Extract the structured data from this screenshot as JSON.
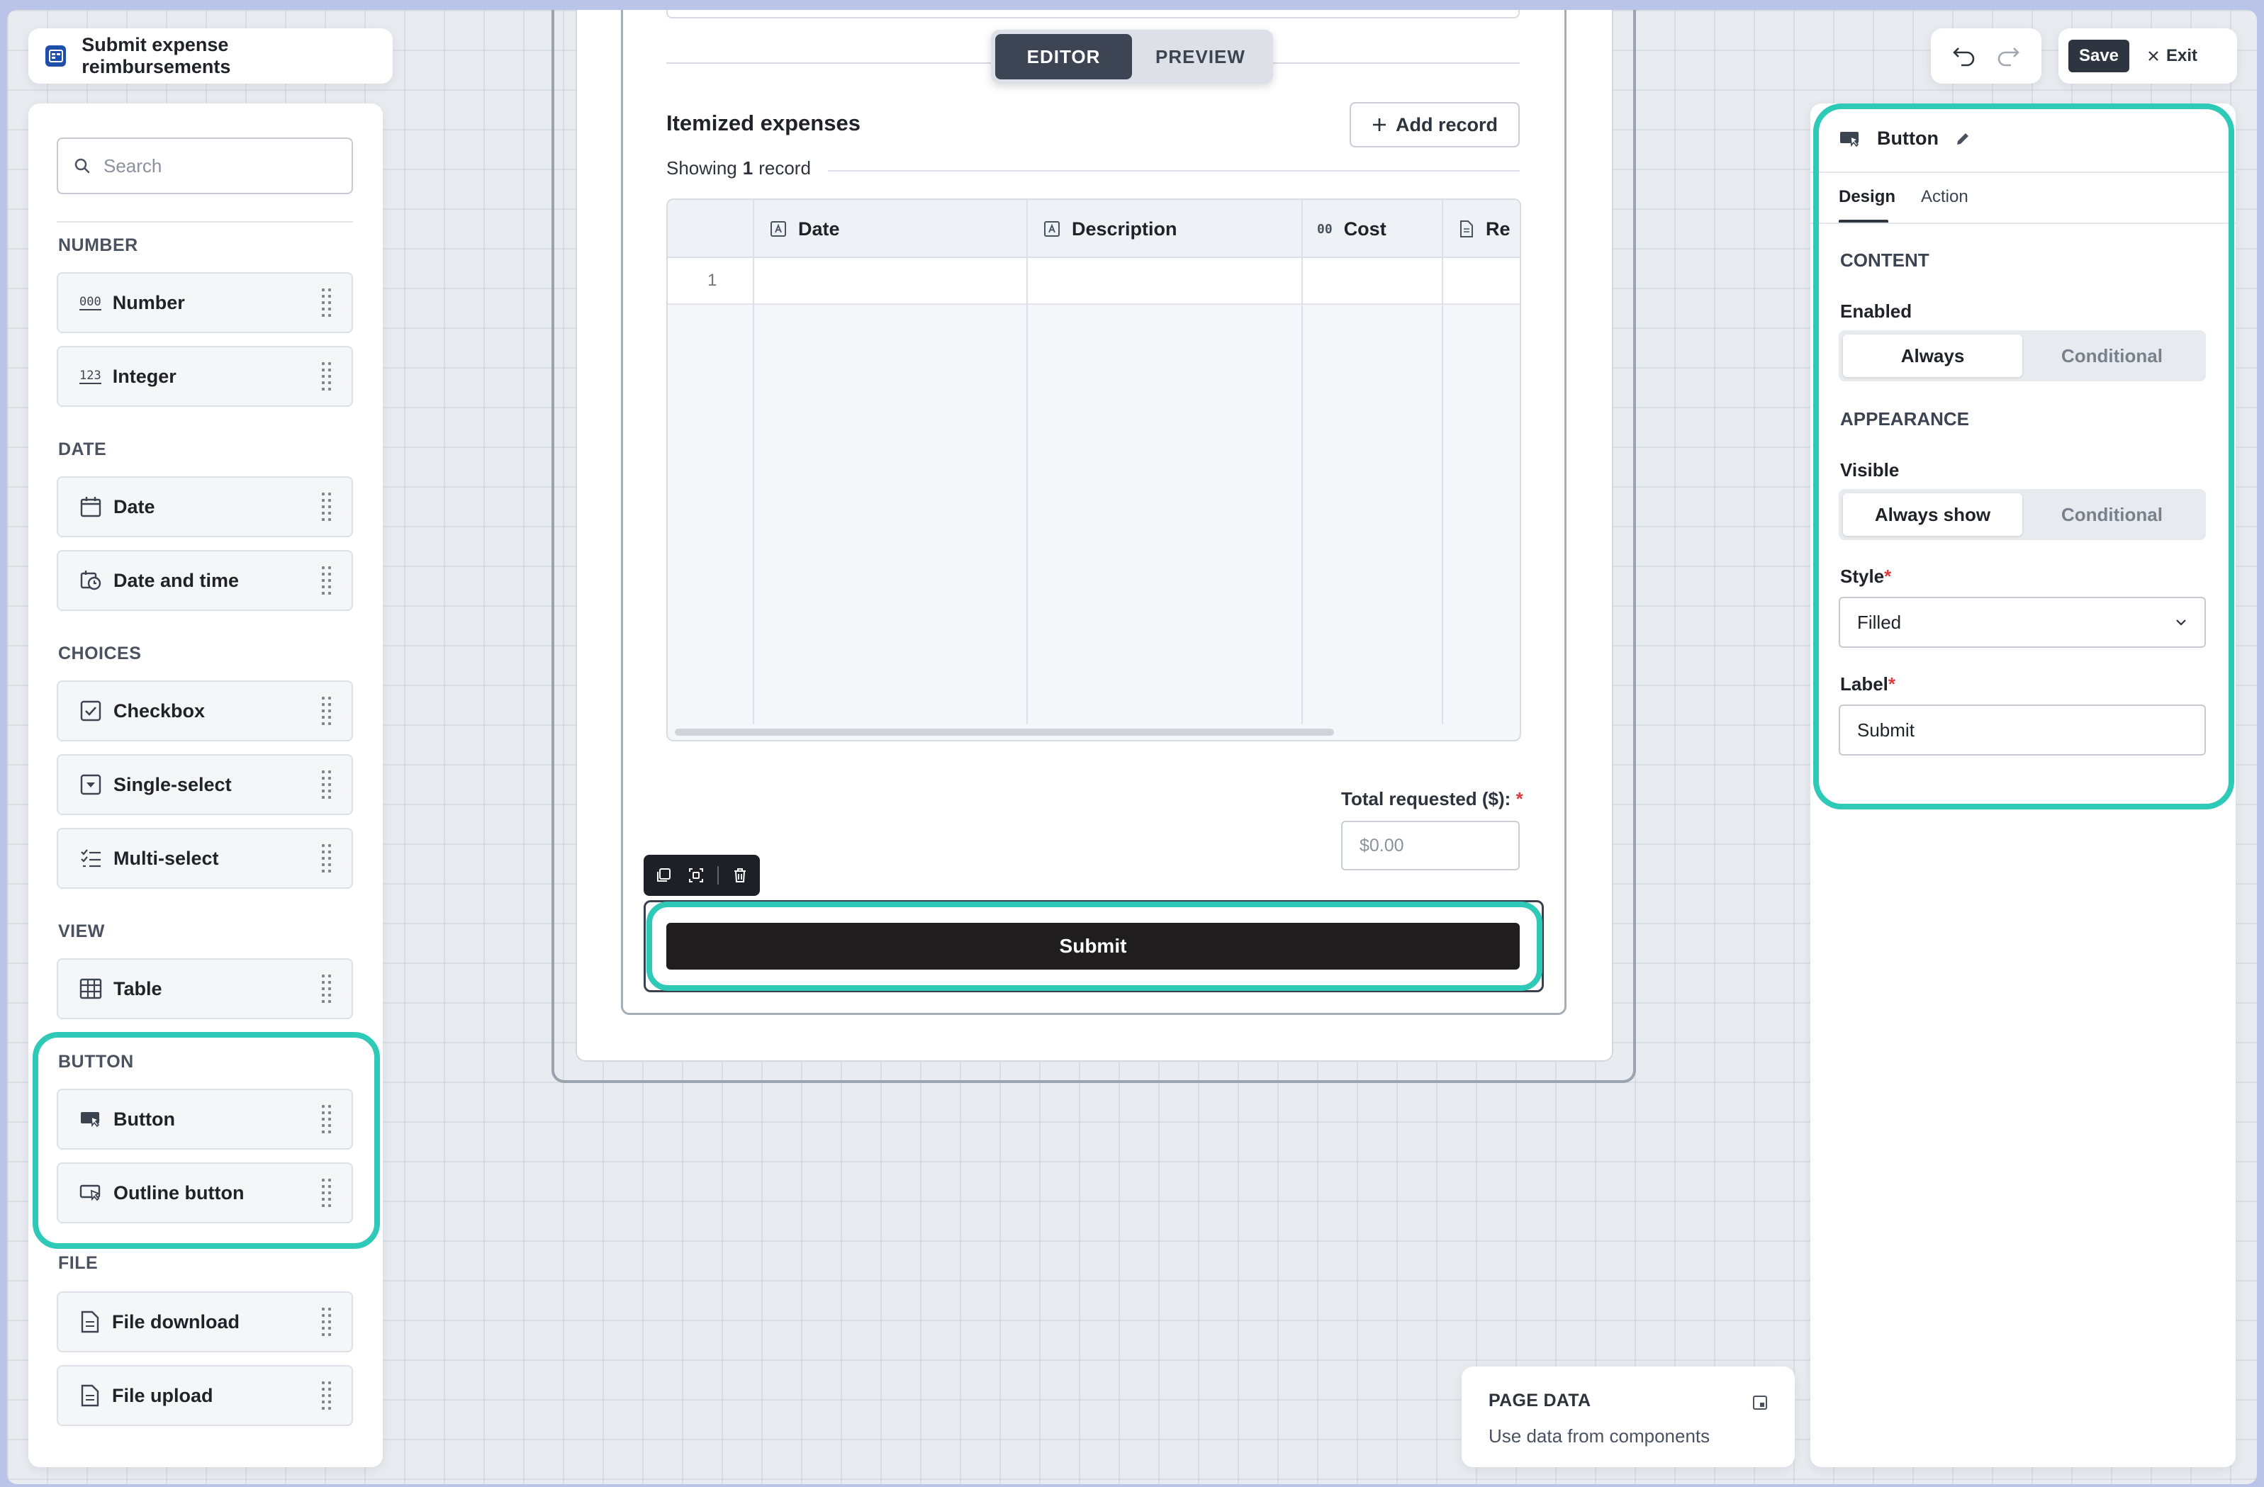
{
  "app": {
    "title": "Submit expense reimbursements"
  },
  "palette": {
    "search_placeholder": "Search",
    "sections": {
      "number": "NUMBER",
      "date": "DATE",
      "choices": "CHOICES",
      "view": "VIEW",
      "button": "BUTTON",
      "file": "FILE"
    },
    "items": {
      "number": "Number",
      "integer": "Integer",
      "date": "Date",
      "date_time": "Date and time",
      "checkbox": "Checkbox",
      "single_select": "Single-select",
      "multi_select": "Multi-select",
      "table": "Table",
      "button": "Button",
      "outline_button": "Outline button",
      "file_download": "File download",
      "file_upload": "File upload"
    },
    "icons": {
      "number": "000",
      "integer": "123"
    }
  },
  "mode_toggle": {
    "editor": "EDITOR",
    "preview": "PREVIEW",
    "active": "editor"
  },
  "form": {
    "section_title": "Itemized expenses",
    "add_record": "Add record",
    "showing_prefix": "Showing",
    "showing_count": "1",
    "showing_suffix": "record",
    "columns": [
      "Date",
      "Description",
      "Cost",
      "Re"
    ],
    "cost_icon": "00",
    "rows": [
      {
        "num": "1"
      }
    ],
    "total_label": "Total requested ($):",
    "total_required": "*",
    "total_placeholder": "$0.00",
    "submit_label": "Submit"
  },
  "page_data_card": {
    "title": "PAGE DATA",
    "subtitle": "Use data from components"
  },
  "toolbar": {
    "save": "Save",
    "exit": "Exit"
  },
  "inspector": {
    "component_name": "Button",
    "tabs": [
      "Design",
      "Action"
    ],
    "active_tab": "Design",
    "content_section": "CONTENT",
    "enabled_label": "Enabled",
    "enabled_options": [
      "Always",
      "Conditional"
    ],
    "enabled_selected": "Always",
    "appearance_section": "APPEARANCE",
    "visible_label": "Visible",
    "visible_options": [
      "Always show",
      "Conditional"
    ],
    "visible_selected": "Always show",
    "style_label": "Style",
    "style_value": "Filled",
    "label_label": "Label",
    "label_value": "Submit",
    "required_mark": "*"
  },
  "colors": {
    "highlight": "#2ec9b7",
    "submit_bg": "#1f1d1d",
    "required": "#e03b3b",
    "accent_dark": "#2f3540"
  }
}
